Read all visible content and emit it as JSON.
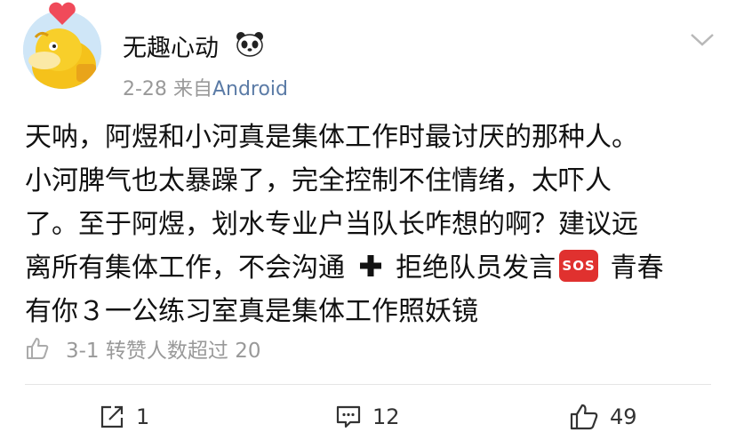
{
  "author": {
    "username": "无趣心动",
    "badge_icon": "panda-emoji-icon",
    "avatar_icon": "psyduck-avatar-icon",
    "avatar_badge_icon": "heart-badge-icon"
  },
  "meta": {
    "date": "2-28",
    "source_prefix": "来自",
    "source": "Android"
  },
  "post": {
    "lines": [
      "天呐，阿煜和小河真是集体工作时最讨厌的那种人。",
      "小河脾气也太暴躁了，完全控制不住情绪，太吓人",
      "了。至于阿煜，划水专业户当队长咋想的啊？建议远",
      "离所有集体工作，不会沟通",
      "拒绝队员发言",
      "青春",
      "有你３一公练习室真是集体工作照妖镜"
    ],
    "sos_label": "SOS"
  },
  "liked_by": {
    "text": "3-1 转赞人数超过 20"
  },
  "actions": {
    "repost_count": "1",
    "comment_count": "12",
    "like_count": "49"
  },
  "colors": {
    "link": "#5b7ba6",
    "muted": "#999999",
    "sos": "#e0312f"
  }
}
